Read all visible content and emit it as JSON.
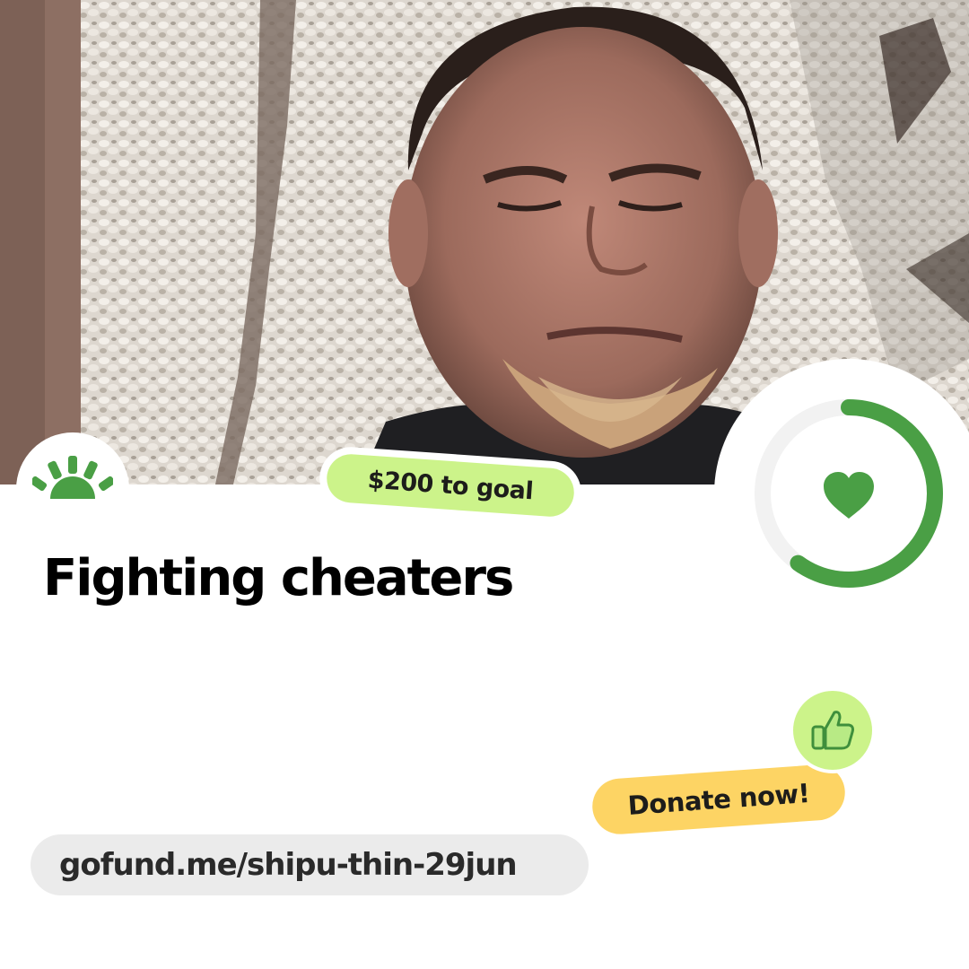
{
  "campaign": {
    "title": "Fighting cheaters",
    "goal_badge": "$200 to goal",
    "donate_label": "Donate now!",
    "url": "gofund.me/shipu-thin-29jun",
    "progress_fraction": 0.6
  },
  "icons": {
    "logo": "gofundme-sunrise-logo",
    "progress_center": "heart-icon",
    "thumb": "thumbs-up-icon"
  },
  "colors": {
    "brand_green": "#4a9f45",
    "ring_track": "#f2f2f2",
    "goal_badge_bg": "#ccf38a",
    "donate_bg": "#fdd464",
    "thumb_bg": "#ccf38a",
    "url_bg": "#ebebeb"
  }
}
